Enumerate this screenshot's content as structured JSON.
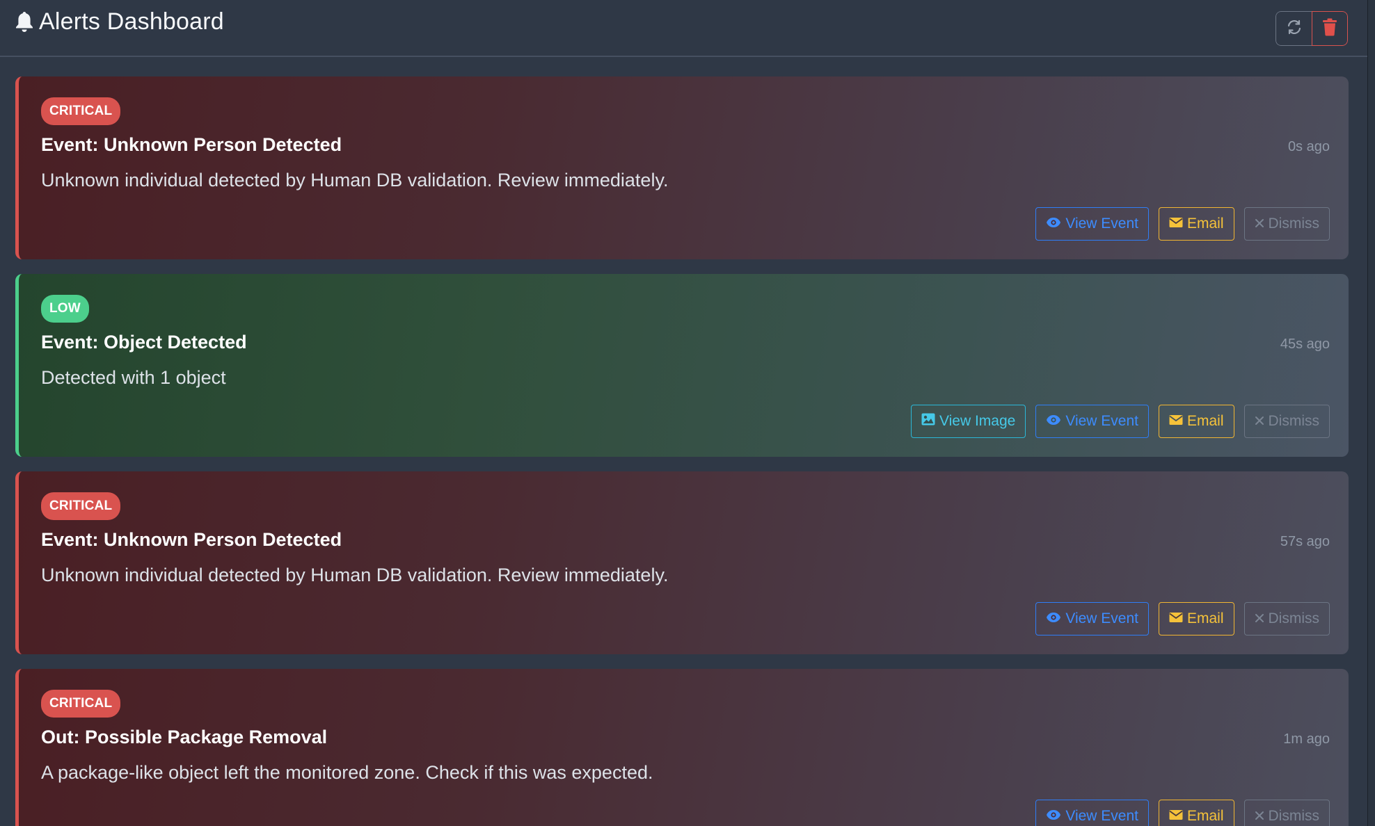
{
  "header": {
    "title": "Alerts Dashboard",
    "bell_icon": "bell-icon",
    "refresh_icon": "refresh-icon",
    "trash_icon": "trash-icon"
  },
  "colors": {
    "critical": "#d9534f",
    "low": "#4ccf8c",
    "view_event": "#3d8cff",
    "view_image": "#46c9e8",
    "email": "#f5c23a",
    "dismiss": "#7c8594"
  },
  "alerts": [
    {
      "severity": "CRITICAL",
      "title": "Event: Unknown Person Detected",
      "time": "0s ago",
      "message": "Unknown individual detected by Human DB validation. Review immediately.",
      "actions": {
        "view_event": "View Event",
        "email": "Email",
        "dismiss": "Dismiss"
      }
    },
    {
      "severity": "LOW",
      "title": "Event: Object Detected",
      "time": "45s ago",
      "message": "Detected with 1 object",
      "actions": {
        "view_image": "View Image",
        "view_event": "View Event",
        "email": "Email",
        "dismiss": "Dismiss"
      }
    },
    {
      "severity": "CRITICAL",
      "title": "Event: Unknown Person Detected",
      "time": "57s ago",
      "message": "Unknown individual detected by Human DB validation. Review immediately.",
      "actions": {
        "view_event": "View Event",
        "email": "Email",
        "dismiss": "Dismiss"
      }
    },
    {
      "severity": "CRITICAL",
      "title": "Out: Possible Package Removal",
      "time": "1m ago",
      "message": "A package-like object left the monitored zone. Check if this was expected.",
      "actions": {
        "view_event": "View Event",
        "email": "Email",
        "dismiss": "Dismiss"
      }
    }
  ]
}
